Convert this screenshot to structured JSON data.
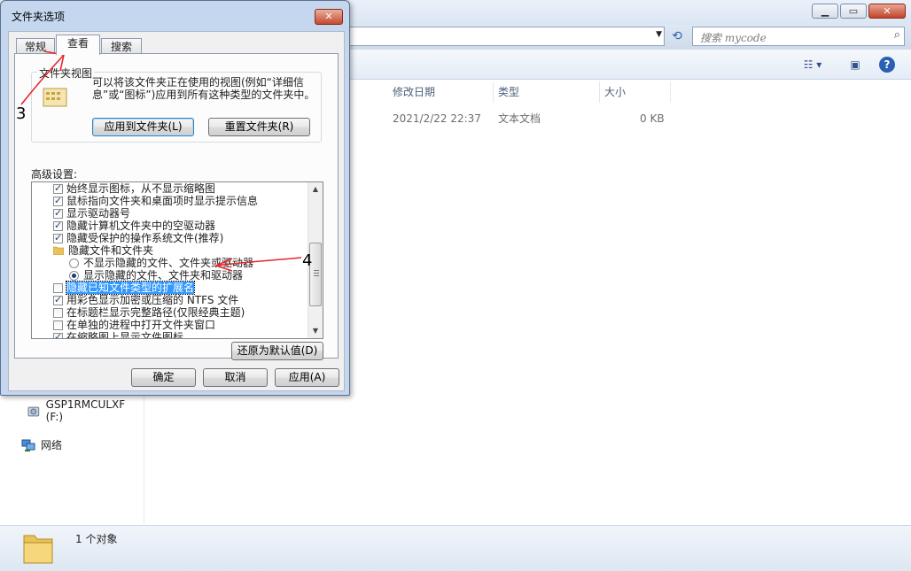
{
  "explorer": {
    "search_placeholder": "搜索 mycode",
    "columns": {
      "date": "修改日期",
      "type": "类型",
      "size": "大小"
    },
    "file": {
      "date": "2021/2/22 22:37",
      "type": "文本文档",
      "size": "0 KB"
    },
    "nav": {
      "drive": "GSP1RMCULXF (F:)",
      "network": "网络"
    },
    "status": "1 个对象"
  },
  "dialog": {
    "title": "文件夹选项",
    "close": "✕",
    "tabs": [
      "常规",
      "查看",
      "搜索"
    ],
    "active_tab": "查看",
    "folder_views": {
      "title": "文件夹视图",
      "desc": "可以将该文件夹正在使用的视图(例如“详细信息”或“图标”)应用到所有这种类型的文件夹中。",
      "apply_btn": "应用到文件夹(L)",
      "reset_btn": "重置文件夹(R)"
    },
    "advanced_label": "高级设置:",
    "advanced_items": [
      {
        "kind": "checkbox",
        "checked": true,
        "label": "始终显示图标，从不显示缩略图"
      },
      {
        "kind": "checkbox",
        "checked": true,
        "label": "鼠标指向文件夹和桌面项时显示提示信息"
      },
      {
        "kind": "checkbox",
        "checked": true,
        "label": "显示驱动器号"
      },
      {
        "kind": "checkbox",
        "checked": true,
        "label": "隐藏计算机文件夹中的空驱动器"
      },
      {
        "kind": "checkbox",
        "checked": true,
        "label": "隐藏受保护的操作系统文件(推荐)"
      },
      {
        "kind": "folder",
        "label": "隐藏文件和文件夹"
      },
      {
        "kind": "radio",
        "checked": false,
        "label": "不显示隐藏的文件、文件夹或驱动器"
      },
      {
        "kind": "radio",
        "checked": true,
        "label": "显示隐藏的文件、文件夹和驱动器"
      },
      {
        "kind": "checkbox",
        "checked": false,
        "selected": true,
        "label": "隐藏已知文件类型的扩展名"
      },
      {
        "kind": "checkbox",
        "checked": true,
        "label": "用彩色显示加密或压缩的 NTFS 文件"
      },
      {
        "kind": "checkbox",
        "checked": false,
        "label": "在标题栏显示完整路径(仅限经典主题)"
      },
      {
        "kind": "checkbox",
        "checked": false,
        "label": "在单独的进程中打开文件夹窗口"
      },
      {
        "kind": "checkbox",
        "checked": true,
        "label": "在缩略图上显示文件图标"
      }
    ],
    "restore_btn": "还原为默认值(D)",
    "ok_btn": "确定",
    "cancel_btn": "取消",
    "apply_btn": "应用(A)"
  },
  "annotations": {
    "step3": "3",
    "step4": "4"
  },
  "colors": {
    "annotation_arrow": "#e8262a",
    "selection": "#3399ff"
  }
}
